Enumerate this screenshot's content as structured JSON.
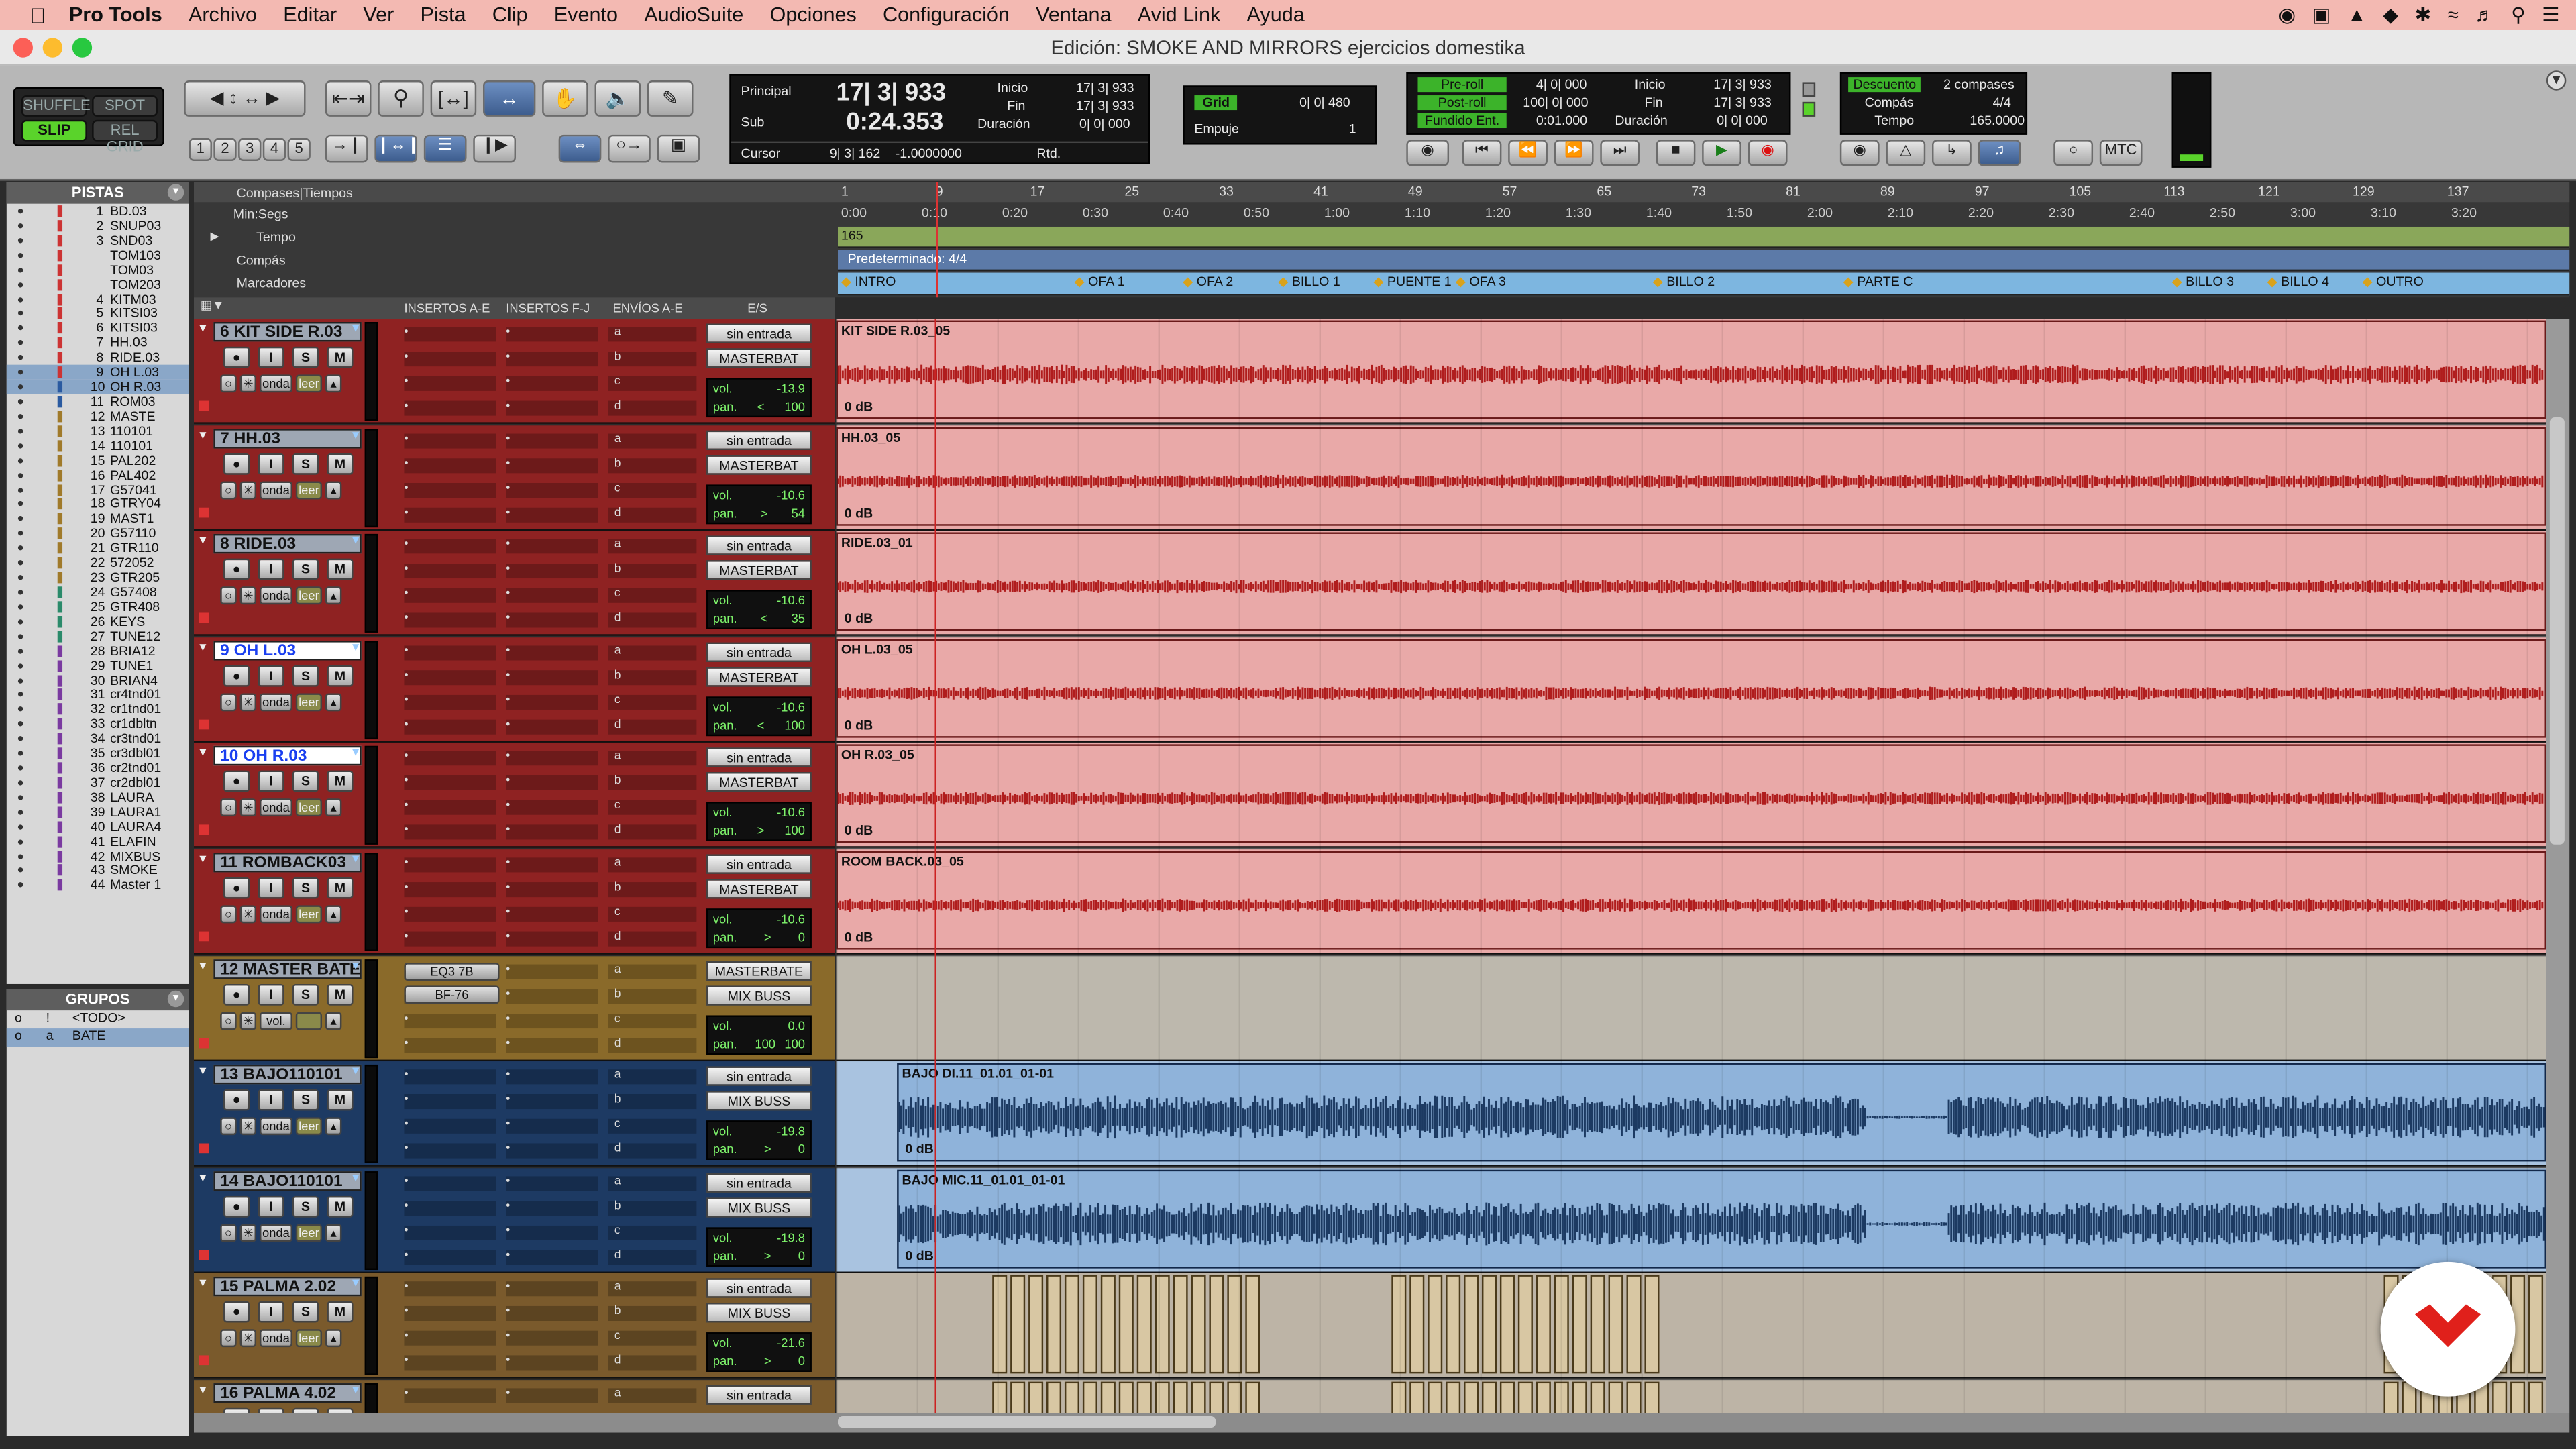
{
  "menu": {
    "app": "Pro Tools",
    "items": [
      "Archivo",
      "Editar",
      "Ver",
      "Pista",
      "Clip",
      "Evento",
      "AudioSuite",
      "Opciones",
      "Configuración",
      "Ventana",
      "Avid Link",
      "Ayuda"
    ]
  },
  "window_title": "Edición: SMOKE AND MIRRORS ejercicios domestika",
  "modes": {
    "shuffle": "SHUFFLE",
    "spot": "SPOT",
    "slip": "SLIP",
    "relgrid": "REL GRID"
  },
  "zoom_presets": [
    "1",
    "2",
    "3",
    "4",
    "5"
  ],
  "counter": {
    "principal_label": "Principal",
    "principal": "17| 3| 933",
    "sub_label": "Sub",
    "sub": "0:24.353",
    "cursor_label": "Cursor",
    "cursor": "9| 3| 162",
    "cursor_val": "-1.0000000",
    "rtd": "Rtd.",
    "inicio_label": "Inicio",
    "inicio": "17| 3| 933",
    "fin_label": "Fin",
    "fin": "17| 3| 933",
    "duracion_label": "Duración",
    "duracion": "0| 0| 000"
  },
  "grid": {
    "grid_label": "Grid",
    "grid_value": "0| 0| 480",
    "empuje_label": "Empuje",
    "empuje_value": "1"
  },
  "transport_counter": {
    "preroll": "Pre-roll",
    "preroll_val": "4| 0| 000",
    "postroll": "Post-roll",
    "postroll_val": "100| 0| 000",
    "fundido": "Fundido Ent.",
    "fundido_val": "0:01.000",
    "inicio_label": "Inicio",
    "inicio": "17| 3| 933",
    "fin_label": "Fin",
    "fin": "17| 3| 933",
    "duracion_label": "Duración",
    "duracion": "0| 0| 000"
  },
  "countoff": {
    "label": "Descuento",
    "value": "2 compases",
    "compas_label": "Compás",
    "compas": "4/4",
    "tempo_label": "Tempo",
    "tempo": "165.0000"
  },
  "mtc": "MTC",
  "tracklist": {
    "title": "PISTAS",
    "tracks": [
      {
        "n": "1",
        "name": "BD.03"
      },
      {
        "n": "2",
        "name": "SNUP03"
      },
      {
        "n": "3",
        "name": "SND03"
      },
      {
        "n": "",
        "name": "TOM103"
      },
      {
        "n": "",
        "name": "TOM03"
      },
      {
        "n": "",
        "name": "TOM203"
      },
      {
        "n": "4",
        "name": "KITM03"
      },
      {
        "n": "5",
        "name": "KITSI03"
      },
      {
        "n": "6",
        "name": "KITSI03"
      },
      {
        "n": "7",
        "name": "HH.03"
      },
      {
        "n": "8",
        "name": "RIDE.03"
      },
      {
        "n": "9",
        "name": "OH L.03",
        "sel": true
      },
      {
        "n": "10",
        "name": "OH R.03",
        "sel": true
      },
      {
        "n": "11",
        "name": "ROM03"
      },
      {
        "n": "12",
        "name": "MASTE"
      },
      {
        "n": "13",
        "name": "110101"
      },
      {
        "n": "14",
        "name": "110101"
      },
      {
        "n": "15",
        "name": "PAL202"
      },
      {
        "n": "16",
        "name": "PAL402"
      },
      {
        "n": "17",
        "name": "G57041"
      },
      {
        "n": "18",
        "name": "GTRY04"
      },
      {
        "n": "19",
        "name": "MAST1"
      },
      {
        "n": "20",
        "name": "G57110"
      },
      {
        "n": "21",
        "name": "GTR110"
      },
      {
        "n": "22",
        "name": "572052"
      },
      {
        "n": "23",
        "name": "GTR205"
      },
      {
        "n": "24",
        "name": "G57408"
      },
      {
        "n": "25",
        "name": "GTR408"
      },
      {
        "n": "26",
        "name": "KEYS"
      },
      {
        "n": "27",
        "name": "TUNE12"
      },
      {
        "n": "28",
        "name": "BRIA12"
      },
      {
        "n": "29",
        "name": "TUNE1"
      },
      {
        "n": "30",
        "name": "BRIAN4"
      },
      {
        "n": "31",
        "name": "cr4tnd01"
      },
      {
        "n": "32",
        "name": "cr1tnd01"
      },
      {
        "n": "33",
        "name": "cr1dbltn"
      },
      {
        "n": "34",
        "name": "cr3tnd01"
      },
      {
        "n": "35",
        "name": "cr3dbl01"
      },
      {
        "n": "36",
        "name": "cr2tnd01"
      },
      {
        "n": "37",
        "name": "cr2dbl01"
      },
      {
        "n": "38",
        "name": "LAURA"
      },
      {
        "n": "39",
        "name": "LAURA1"
      },
      {
        "n": "40",
        "name": "LAURA4"
      },
      {
        "n": "41",
        "name": "ELAFIN"
      },
      {
        "n": "42",
        "name": "MIXBUS"
      },
      {
        "n": "43",
        "name": "SMOKE"
      },
      {
        "n": "44",
        "name": "Master 1"
      }
    ]
  },
  "groups": {
    "title": "GRUPOS",
    "items": [
      {
        "id": "!",
        "name": "<TODO>"
      },
      {
        "id": "a",
        "name": "BATE"
      }
    ]
  },
  "rulers": {
    "header": "Compases|Tiempos",
    "minsec": "Min:Segs",
    "tempo": "Tempo",
    "compas": "Compás",
    "marcadores": "Marcadores",
    "tempo_value": "165",
    "meter_value": "Predeterminado: 4/4",
    "bars": [
      "1",
      "9",
      "17",
      "25",
      "33",
      "41",
      "49",
      "57",
      "65",
      "73",
      "81",
      "89",
      "97",
      "105",
      "113",
      "121",
      "129",
      "137"
    ],
    "times": [
      "0:00",
      "0:10",
      "0:20",
      "0:30",
      "0:40",
      "0:50",
      "1:00",
      "1:10",
      "1:20",
      "1:30",
      "1:40",
      "1:50",
      "2:00",
      "2:10",
      "2:20",
      "2:30",
      "2:40",
      "2:50",
      "3:00",
      "3:10",
      "3:20"
    ],
    "markers": [
      "INTRO",
      "OFA 1",
      "OFA 2",
      "BILLO 1",
      "PUENTE 1",
      "OFA 3",
      "BILLO 2",
      "PARTE C",
      "BILLO 3",
      "BILLO 4",
      "OUTRO"
    ]
  },
  "columns": {
    "insertos_ae": "INSERTOS A-E",
    "insertos_fj": "INSERTOS F-J",
    "envios_ae": "ENVÍOS A-E",
    "es": "E/S"
  },
  "sends": [
    "a",
    "b",
    "c",
    "d"
  ],
  "tracks": [
    {
      "name": "6 KIT SIDE R.03",
      "color": "red",
      "input": "sin entrada",
      "output": "MASTERBAT",
      "vol": "-13.9",
      "pan": "100",
      "pan_dir": "<",
      "region": "KIT SIDE R.03_05",
      "gain": "0 dB",
      "view": "onda",
      "auto": "leer"
    },
    {
      "name": "7      HH.03",
      "color": "red",
      "input": "sin entrada",
      "output": "MASTERBAT",
      "vol": "-10.6",
      "pan": "54",
      "pan_dir": ">",
      "region": "HH.03_05",
      "gain": "0 dB",
      "view": "onda",
      "auto": "leer"
    },
    {
      "name": "8      RIDE.03",
      "color": "red",
      "input": "sin entrada",
      "output": "MASTERBAT",
      "vol": "-10.6",
      "pan": "35",
      "pan_dir": "<",
      "region": "RIDE.03_01",
      "gain": "0 dB",
      "view": "onda",
      "auto": "leer"
    },
    {
      "name": "9      OH L.03",
      "color": "red",
      "selected": true,
      "input": "sin entrada",
      "output": "MASTERBAT",
      "vol": "-10.6",
      "pan": "100",
      "pan_dir": "<",
      "region": "OH L.03_05",
      "gain": "0 dB",
      "view": "onda",
      "auto": "leer"
    },
    {
      "name": "10      OH R.03",
      "color": "red",
      "selected": true,
      "input": "sin entrada",
      "output": "MASTERBAT",
      "vol": "-10.6",
      "pan": "100",
      "pan_dir": ">",
      "region": "OH R.03_05",
      "gain": "0 dB",
      "view": "onda",
      "auto": "leer"
    },
    {
      "name": "11 ROMBACK03",
      "color": "red",
      "input": "sin entrada",
      "output": "MASTERBAT",
      "vol": "-10.6",
      "pan": "0",
      "pan_dir": ">",
      "region": "ROOM BACK.03_05",
      "gain": "0 dB",
      "view": "onda",
      "auto": "leer"
    },
    {
      "name": "12 MASTER BATE",
      "color": "gold",
      "input": "MASTERBATE",
      "output": "MIX BUSS",
      "vol": "0.0",
      "pan": "100",
      "pan2": "100",
      "inserts": [
        "EQ3 7B",
        "BF-76"
      ],
      "view": "vol.",
      "auto": ""
    },
    {
      "name": "13 BAJO110101",
      "color": "blue",
      "input": "sin entrada",
      "output": "MIX BUSS",
      "vol": "-19.8",
      "pan": "0",
      "pan_dir": ">",
      "region": "BAJO DI.11_01.01_01-01",
      "gain": "0 dB",
      "view": "onda",
      "auto": "leer"
    },
    {
      "name": "14 BAJO110101",
      "color": "blue",
      "input": "sin entrada",
      "output": "MIX BUSS",
      "vol": "-19.8",
      "pan": "0",
      "pan_dir": ">",
      "region": "BAJO MIC.11_01.01_01-01",
      "gain": "0 dB",
      "view": "onda",
      "auto": "leer"
    },
    {
      "name": "15 PALMA 2.02",
      "color": "tan",
      "input": "sin entrada",
      "output": "MIX BUSS",
      "vol": "-21.6",
      "pan": "0",
      "pan_dir": ">",
      "view": "onda",
      "auto": "leer"
    },
    {
      "name": "16 PALMA 4.02",
      "color": "tan",
      "input": "sin entrada",
      "output": "",
      "vol": "",
      "pan": "",
      "view": "onda",
      "auto": "leer"
    }
  ],
  "colors": {
    "drums": "#9e2a2a",
    "drum_region": "#e8a7a6",
    "bus": "#8a6a2a",
    "bass": "#1f3d66",
    "bass_region": "#8fb3da",
    "palma": "#7a5a2c"
  }
}
